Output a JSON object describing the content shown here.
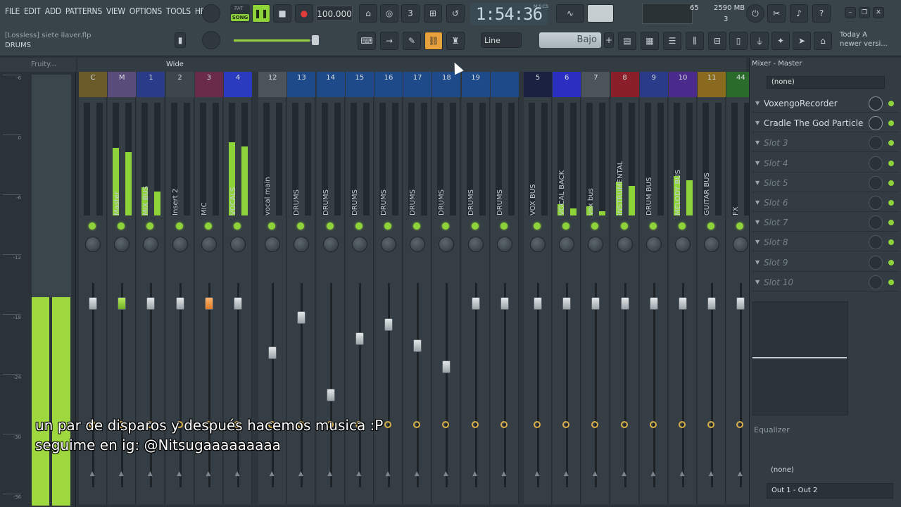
{
  "menu": [
    "FILE",
    "EDIT",
    "ADD",
    "PATTERNS",
    "VIEW",
    "OPTIONS",
    "TOOLS",
    "HELP"
  ],
  "project": {
    "name": "[Lossless] siete llaver.flp",
    "pattern": "DRUMS"
  },
  "transport": {
    "pat_label": "PAT",
    "song_label": "SONG",
    "tempo": "100.000",
    "time": "1:54:36",
    "time_unit": "M:S:CS"
  },
  "cpu": {
    "value": "65",
    "memory": "2590 MB",
    "polyphony": "3"
  },
  "snap": {
    "value": "Line"
  },
  "preset": {
    "value": "Bajo"
  },
  "hint": {
    "line1": "Today  A",
    "line2": "newer versi..."
  },
  "browser": {
    "title": "Fruity...",
    "scale": [
      "-6",
      "0",
      "-6",
      "-12",
      "-18",
      "-24",
      "-30",
      "-36"
    ]
  },
  "mixer_toolbar": {
    "mode": "Wide"
  },
  "strips": [
    {
      "num": "C",
      "label": "",
      "color": "#6a5a2a"
    },
    {
      "num": "M",
      "label": "Master",
      "color": "#5a4c7a"
    },
    {
      "num": "1",
      "label": "MIX BUS",
      "color": "#2a3b8a"
    },
    {
      "num": "2",
      "label": "Insert 2",
      "color": "#3d464c"
    },
    {
      "num": "3",
      "label": "MIC",
      "color": "#6a2a4a"
    },
    {
      "num": "4",
      "label": "VOCALS",
      "color": "#2a3bbf"
    },
    {
      "num": "12",
      "label": "vocal main",
      "color": "#4a545a"
    },
    {
      "num": "13",
      "label": "DRUMS",
      "color": "#1f4a8a"
    },
    {
      "num": "14",
      "label": "DRUMS",
      "color": "#1f4a8a"
    },
    {
      "num": "15",
      "label": "DRUMS",
      "color": "#1f4a8a"
    },
    {
      "num": "16",
      "label": "DRUMS",
      "color": "#1f4a8a"
    },
    {
      "num": "17",
      "label": "DRUMS",
      "color": "#1f4a8a"
    },
    {
      "num": "18",
      "label": "DRUMS",
      "color": "#1f4a8a"
    },
    {
      "num": "19",
      "label": "DRUMS",
      "color": "#1f4a8a"
    },
    {
      "num": "",
      "label": "DRUMS",
      "color": "#1f4a8a"
    },
    {
      "num": "5",
      "label": "VOX BUS",
      "color": "#1a2040"
    },
    {
      "num": "6",
      "label": "VOCAL BACK",
      "color": "#2a2fbf"
    },
    {
      "num": "7",
      "label": "vox bus",
      "color": "#4a545a"
    },
    {
      "num": "8",
      "label": "INSTRUMENTAL",
      "color": "#8a1f2a"
    },
    {
      "num": "9",
      "label": "DRUM BUS",
      "color": "#2a3b8a"
    },
    {
      "num": "10",
      "label": "MELODY BUS",
      "color": "#4a2a8a"
    },
    {
      "num": "11",
      "label": "GUITAR BUS",
      "color": "#8a6a1f"
    },
    {
      "num": "44",
      "label": "FX",
      "color": "#2a6a2a"
    }
  ],
  "master_panel": {
    "title": "Mixer - Master",
    "input": "(none)",
    "slots": [
      "VoxengoRecorder",
      "Cradle The God Particle",
      "Slot 3",
      "Slot 4",
      "Slot 5",
      "Slot 6",
      "Slot 7",
      "Slot 8",
      "Slot 9",
      "Slot 10"
    ],
    "equalizer_label": "Equalizer",
    "sidechain": "(none)",
    "output": "Out 1 - Out 2"
  },
  "subtitle": {
    "line1": "un par de disparos y después hacemos musica :P",
    "line2": "seguime en ig: @Nitsugaaaaaaaaa"
  }
}
